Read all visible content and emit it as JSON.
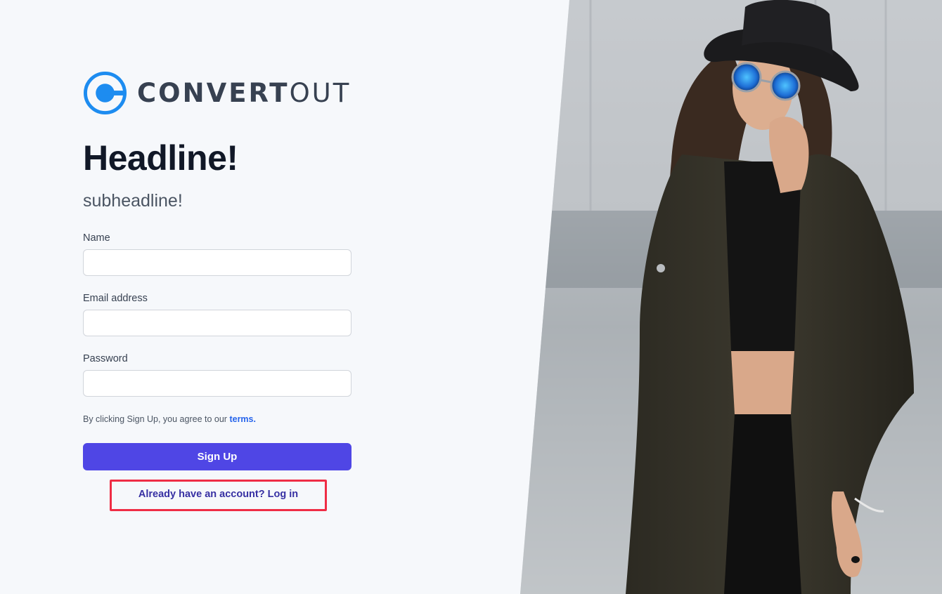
{
  "brand": {
    "name_bold": "CONVERT",
    "name_light": "OUT",
    "logo_color": "#1d8cf0"
  },
  "hero": {
    "headline": "Headline!",
    "subheadline": "subheadline!"
  },
  "form": {
    "name_label": "Name",
    "name_value": "",
    "email_label": "Email address",
    "email_value": "",
    "password_label": "Password",
    "password_value": "",
    "terms_prefix": "By clicking Sign Up, you agree to our ",
    "terms_link": "terms.",
    "submit_label": "Sign Up",
    "login_prompt": "Already have an account? Log in"
  },
  "colors": {
    "accent": "#4f46e5",
    "link": "#2563eb",
    "highlight_border": "#ef2d45",
    "background": "#f6f8fb"
  }
}
